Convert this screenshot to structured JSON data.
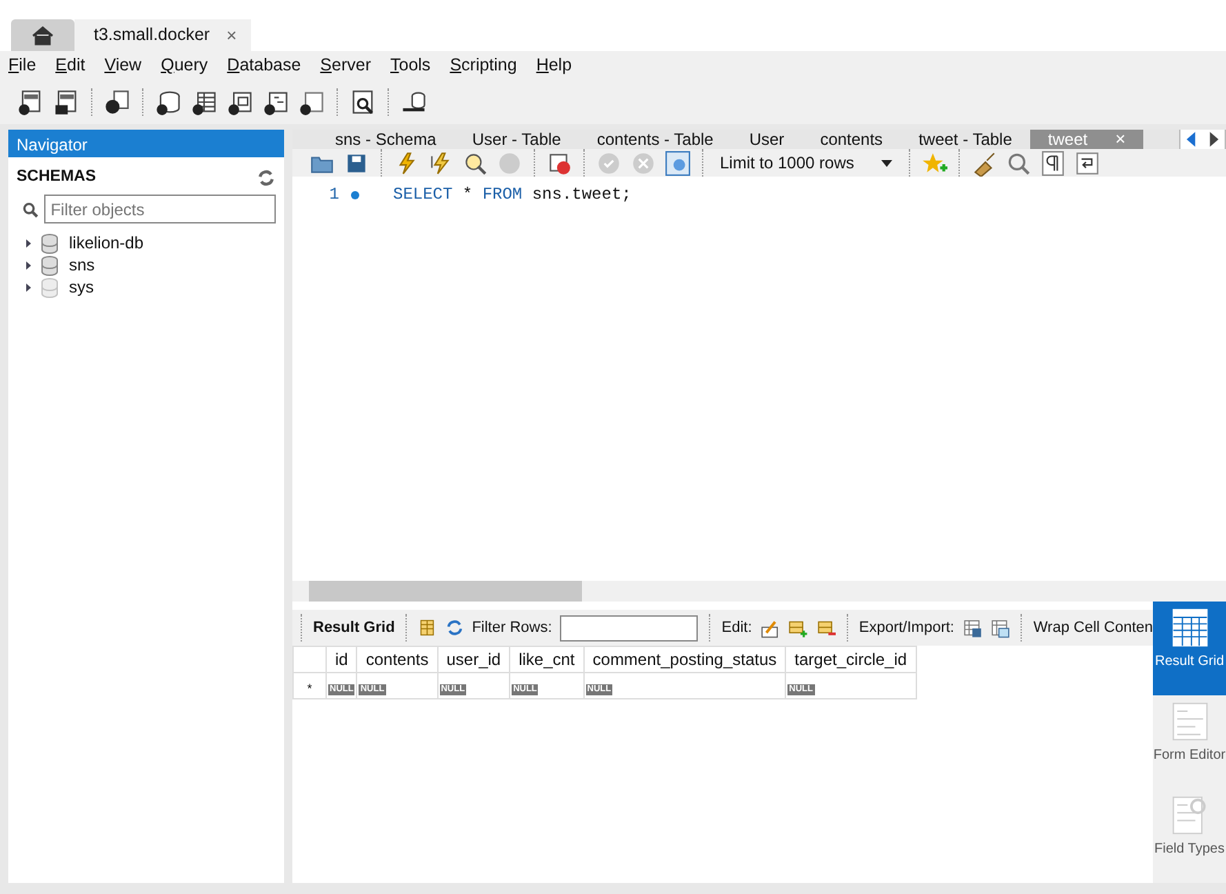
{
  "connection_tabs": [
    {
      "label": "t3.small.docker",
      "close": "×",
      "selected": true
    }
  ],
  "menu": [
    "File",
    "Edit",
    "View",
    "Query",
    "Database",
    "Server",
    "Tools",
    "Scripting",
    "Help"
  ],
  "navigator": {
    "title": "Navigator",
    "section": "SCHEMAS",
    "filter": {
      "placeholder": "Filter objects"
    },
    "schemas": [
      {
        "name": "likelion-db",
        "muted": false,
        "expanded": false
      },
      {
        "name": "sns",
        "muted": false,
        "expanded": false
      },
      {
        "name": "sys",
        "muted": true,
        "expanded": false
      }
    ]
  },
  "editor_tabs": [
    {
      "label": "sns - Schema",
      "selected": false
    },
    {
      "label": "User - Table",
      "selected": false
    },
    {
      "label": "contents - Table",
      "selected": false
    },
    {
      "label": "User",
      "selected": false
    },
    {
      "label": "contents",
      "selected": false
    },
    {
      "label": "tweet - Table",
      "selected": false
    },
    {
      "label": "tweet",
      "close": "×",
      "selected": true
    }
  ],
  "editor_toolbar": {
    "limit": "Limit to 1000 rows"
  },
  "editor": {
    "lines": [
      {
        "number": "1",
        "tokens": [
          {
            "text": "SELECT",
            "kind": "keyword"
          },
          {
            "text": " * ",
            "kind": "plain"
          },
          {
            "text": "FROM",
            "kind": "keyword"
          },
          {
            "text": " sns.tweet;",
            "kind": "plain"
          }
        ]
      }
    ]
  },
  "result_toolbar": {
    "title": "Result Grid",
    "filter_label": "Filter Rows:",
    "edit_label": "Edit:",
    "export_label": "Export/Import:",
    "wrap_label": "Wrap Cell Conten"
  },
  "grid": {
    "columns": [
      "id",
      "contents",
      "user_id",
      "like_cnt",
      "comment_posting_status",
      "target_circle_id"
    ],
    "rows": [
      {
        "marker": "*",
        "cells": [
          "NULL",
          "NULL",
          "NULL",
          "NULL",
          "NULL",
          "NULL"
        ]
      }
    ]
  },
  "side_panel": [
    {
      "label": "Result Grid",
      "selected": true
    },
    {
      "label": "Form Editor",
      "selected": false
    },
    {
      "label": "Field Types",
      "selected": false
    }
  ]
}
